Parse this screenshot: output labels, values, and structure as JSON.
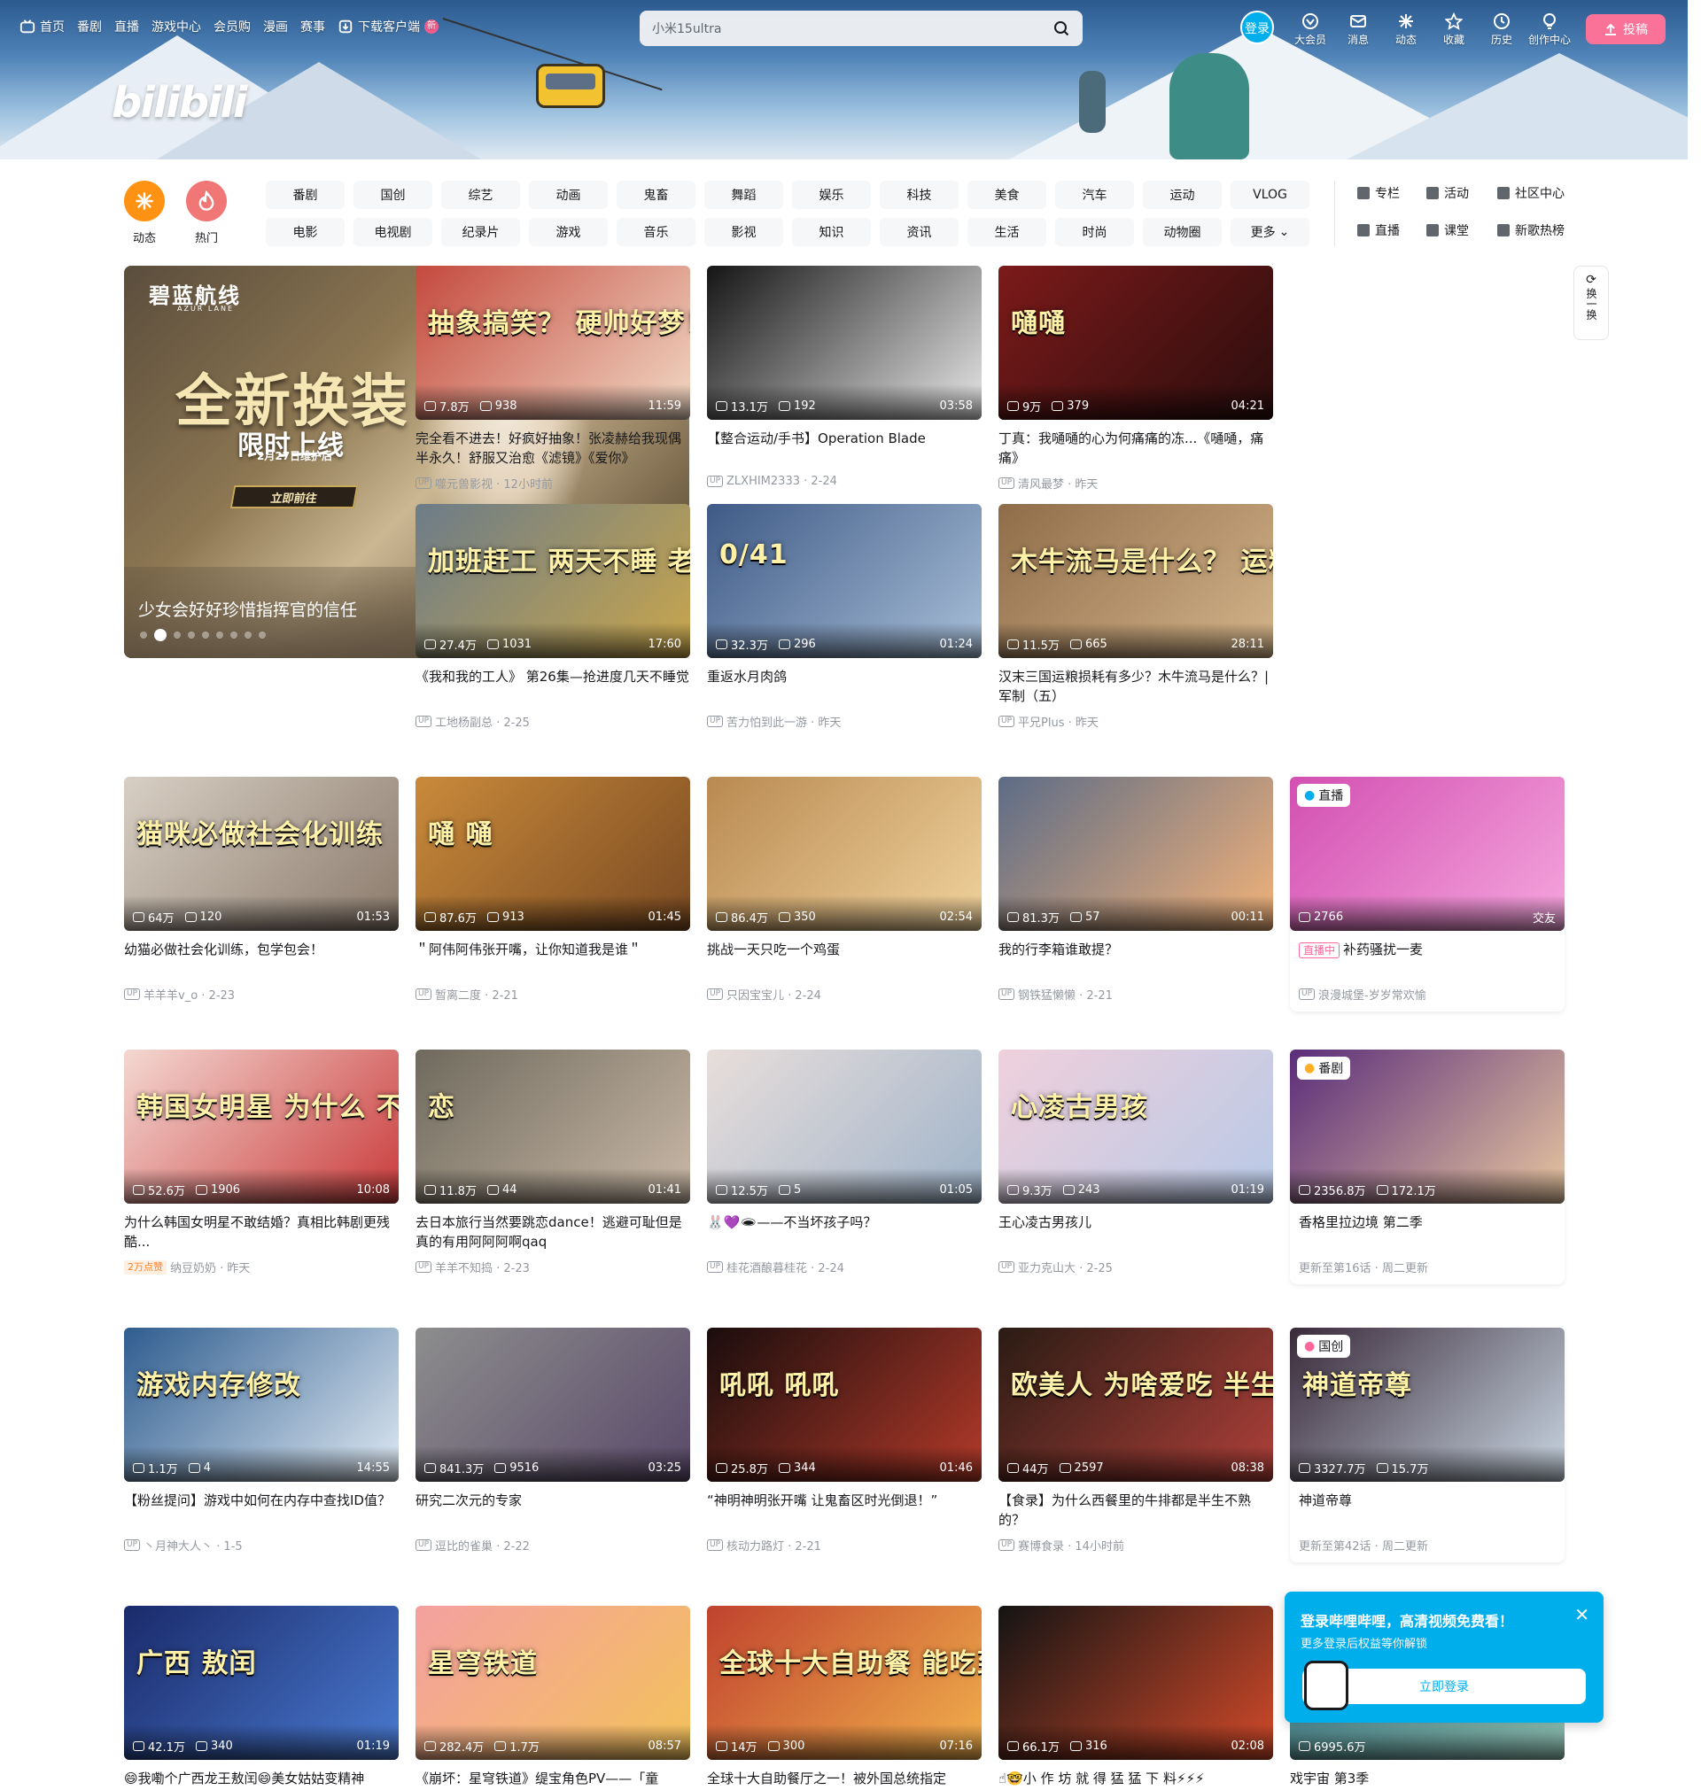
{
  "topnav": {
    "items": [
      {
        "label": "首页",
        "icon": "tv-icon"
      },
      {
        "label": "番剧"
      },
      {
        "label": "直播"
      },
      {
        "label": "游戏中心"
      },
      {
        "label": "会员购"
      },
      {
        "label": "漫画"
      },
      {
        "label": "赛事"
      },
      {
        "label": "下载客户端",
        "icon": "download-icon",
        "badge": "新"
      }
    ]
  },
  "logo": "bilibili",
  "search": {
    "value": "小米15ultra"
  },
  "user": {
    "login": "登录",
    "items": [
      {
        "label": "大会员",
        "icon": "vip-icon"
      },
      {
        "label": "消息",
        "icon": "message-icon"
      },
      {
        "label": "动态",
        "icon": "dynamic-icon"
      },
      {
        "label": "收藏",
        "icon": "star-icon"
      },
      {
        "label": "历史",
        "icon": "clock-icon"
      },
      {
        "label": "创作中心",
        "icon": "bulb-icon"
      }
    ],
    "upload": "投稿"
  },
  "channels": {
    "big": [
      {
        "label": "动态",
        "color": "#ff9212"
      },
      {
        "label": "热门",
        "color": "#f07775"
      }
    ],
    "pills": [
      "番剧",
      "国创",
      "综艺",
      "动画",
      "鬼畜",
      "舞蹈",
      "娱乐",
      "科技",
      "美食",
      "汽车",
      "运动",
      "VLOG",
      "电影",
      "电视剧",
      "纪录片",
      "游戏",
      "音乐",
      "影视",
      "知识",
      "资讯",
      "生活",
      "时尚",
      "动物圈",
      "更多"
    ],
    "links": [
      {
        "label": "专栏",
        "icon": "column-icon"
      },
      {
        "label": "活动",
        "icon": "flag-icon"
      },
      {
        "label": "社区中心",
        "icon": "community-icon"
      },
      {
        "label": "直播",
        "icon": "live-icon"
      },
      {
        "label": "课堂",
        "icon": "class-icon"
      },
      {
        "label": "新歌热榜",
        "icon": "music-chart-icon"
      }
    ]
  },
  "carousel": {
    "brand": "碧蓝航线",
    "brand_sub": "AZUR LANE",
    "headline": "全新换装",
    "subline": "限时上线",
    "date": "2月27日维护后",
    "cta": "立即前往",
    "title": "少女会好好珍惜指挥官的信任",
    "dots": 9,
    "active_dot": 1
  },
  "refresh": {
    "label": "换一换"
  },
  "cards": [
    {
      "title": "完全看不进去！好疯好抽象！张凌赫给我现偶半永久！舒服又治愈《滤镜》《爱你》",
      "views": "7.8万",
      "danmaku": "938",
      "duration": "11:59",
      "author": "噬元兽影视",
      "date": "12小时前",
      "art": "抽象搞笑？  硬帅好梦！"
    },
    {
      "title": "【整合运动/手书】Operation Blade",
      "views": "13.1万",
      "danmaku": "192",
      "duration": "03:58",
      "author": "ZLXHIM2333",
      "date": "2-24",
      "art": ""
    },
    {
      "title": "丁真：我嗵嗵的心为何痛痛的冻...《嗵嗵，痛痛》",
      "views": "9万",
      "danmaku": "379",
      "duration": "04:21",
      "author": "清风最梦",
      "date": "昨天",
      "art": "嗵嗵"
    },
    {
      "title": "《我和我的工人》 第26集—抢进度几天不睡觉",
      "views": "27.4万",
      "danmaku": "1031",
      "duration": "17:60",
      "author": "工地杨副总",
      "date": "2-25",
      "art": "加班赶工 两天不睡 老魏见人就骂"
    },
    {
      "title": "重返水月肉鸽",
      "views": "32.3万",
      "danmaku": "296",
      "duration": "01:24",
      "author": "苦力怕到此一游",
      "date": "昨天",
      "art": "0/41"
    },
    {
      "title": "汉末三国运粮损耗有多少？木牛流马是什么？| 军制（五）",
      "views": "11.5万",
      "danmaku": "665",
      "duration": "28:11",
      "author": "平兄Plus",
      "date": "昨天",
      "art": "木牛流马是什么？ 运粮损耗有多少？"
    },
    {
      "title": "幼猫必做社会化训练，包学包会！",
      "views": "64万",
      "danmaku": "120",
      "duration": "01:53",
      "author": "羊羊羊v_o",
      "date": "2-23",
      "art": "猫咪必做社会化训练"
    },
    {
      "title": "＂阿伟阿伟张开嘴，让你知道我是谁＂",
      "views": "87.6万",
      "danmaku": "913",
      "duration": "01:45",
      "author": "暂离二度",
      "date": "2-21",
      "art": "嗵    嗵"
    },
    {
      "title": "挑战一天只吃一个鸡蛋",
      "views": "86.4万",
      "danmaku": "350",
      "duration": "02:54",
      "author": "只因宝宝儿",
      "date": "2-24",
      "art": ""
    },
    {
      "title": "我的行李箱谁敢提？",
      "views": "81.3万",
      "danmaku": "57",
      "duration": "00:11",
      "author": "钢铁猛懒懒",
      "date": "2-21",
      "art": ""
    },
    {
      "title": "补药骚扰一麦",
      "views": "2766",
      "danmaku": "",
      "duration": "交友",
      "author": "浪漫城堡-岁岁常欢愉",
      "date": "",
      "art": "",
      "tag": "直播",
      "live": "直播中"
    },
    {
      "title": "为什么韩国女明星不敢结婚？真相比韩剧更残酷...",
      "views": "52.6万",
      "danmaku": "1906",
      "duration": "10:08",
      "author": "纳豆奶奶",
      "date": "昨天",
      "art": "韩国女明星 为什么 不敢结婚？",
      "hot": "2万点赞"
    },
    {
      "title": "去日本旅行当然要跳恋dance！逃避可耻但是真的有用阿阿阿啊qaq",
      "views": "11.8万",
      "danmaku": "44",
      "duration": "01:41",
      "author": "羊羊不知捣",
      "date": "2-23",
      "art": "恋"
    },
    {
      "title": "🐰💜🕳——不当坏孩子吗？",
      "views": "12.5万",
      "danmaku": "5",
      "duration": "01:05",
      "author": "桂花酒酿暮桂花",
      "date": "2-24",
      "art": ""
    },
    {
      "title": "王心凌古男孩儿",
      "views": "9.3万",
      "danmaku": "243",
      "duration": "01:19",
      "author": "亚力克山大",
      "date": "2-25",
      "art": "心凌古男孩"
    },
    {
      "title": "香格里拉边境 第二季",
      "views": "2356.8万",
      "danmaku": "172.1万",
      "duration": "",
      "author": "更新至第16话 · 周二更新",
      "date": "",
      "art": "",
      "tag": "番剧"
    },
    {
      "title": "【粉丝提问】游戏中如何在内存中查找ID值？",
      "views": "1.1万",
      "danmaku": "4",
      "duration": "14:55",
      "author": "丶月神大人丶",
      "date": "1-5",
      "art": "游戏内存修改"
    },
    {
      "title": "研究二次元的专家",
      "views": "841.3万",
      "danmaku": "9516",
      "duration": "03:25",
      "author": "逗比的雀巢",
      "date": "2-22",
      "art": ""
    },
    {
      "title": "“神明神明张开嘴 让鬼畜区时光倒退！”",
      "views": "25.8万",
      "danmaku": "344",
      "duration": "01:46",
      "author": "核动力路灯",
      "date": "2-21",
      "art": "吼吼  吼吼"
    },
    {
      "title": "【食录】为什么西餐里的牛排都是半生不熟的？",
      "views": "44万",
      "danmaku": "2597",
      "duration": "08:38",
      "author": "赛博食录",
      "date": "14小时前",
      "art": "欧美人 为啥爱吃 半生牛排？"
    },
    {
      "title": "神道帝尊",
      "views": "3327.7万",
      "danmaku": "15.7万",
      "duration": "",
      "author": "更新至第42话 · 周二更新",
      "date": "",
      "art": "神道帝尊",
      "tag": "国创"
    },
    {
      "title": "😄我嘞个广西龙王敖闰😄美女姑姑变精神",
      "views": "42.1万",
      "danmaku": "340",
      "duration": "01:19",
      "author": "",
      "date": "",
      "art": "广西  敖闰"
    },
    {
      "title": "《崩坏：星穹铁道》缇宝角色PV——「童",
      "views": "282.4万",
      "danmaku": "1.7万",
      "duration": "08:57",
      "author": "",
      "date": "",
      "art": "星穹铁道"
    },
    {
      "title": "全球十大自助餐厅之一！被外国总统指定",
      "views": "14万",
      "danmaku": "300",
      "duration": "07:16",
      "author": "",
      "date": "",
      "art": "全球十大自助餐 能吃到啥？"
    },
    {
      "title": "☝🤓小 作 坊 就 得 猛 猛 下 料⚡⚡⚡",
      "views": "66.1万",
      "danmaku": "316",
      "duration": "02:08",
      "author": "",
      "date": "",
      "art": ""
    },
    {
      "title": "戏宇宙 第3季",
      "views": "6995.6万",
      "danmaku": "",
      "duration": "",
      "author": "",
      "date": "",
      "art": ""
    }
  ],
  "popup": {
    "title": "登录哔哩哔哩，高清视频免费看！",
    "subtitle": "更多登录后权益等你解锁",
    "button": "立即登录"
  }
}
